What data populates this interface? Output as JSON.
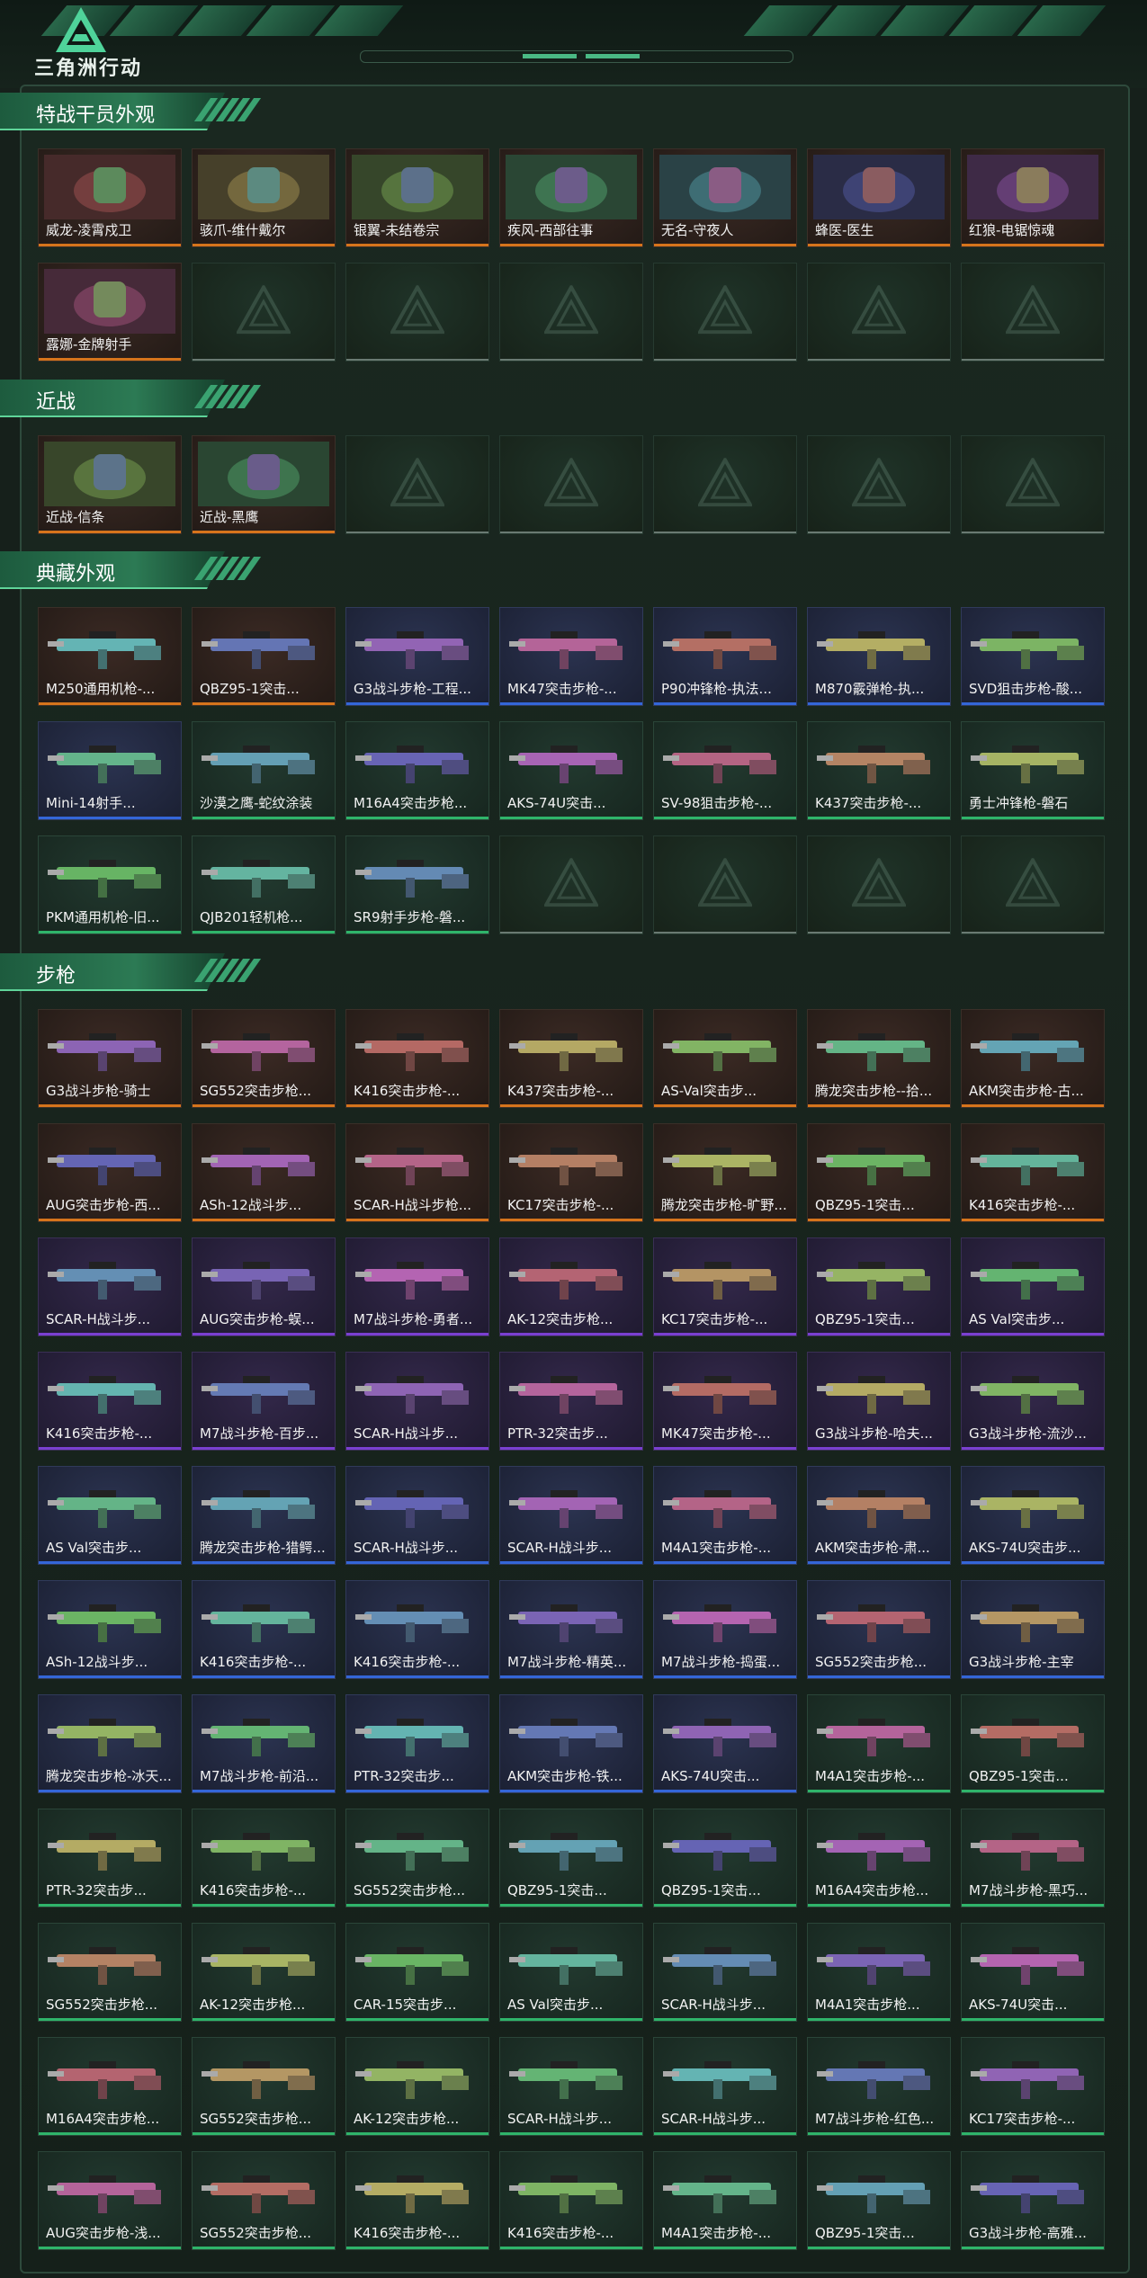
{
  "header": {
    "logo_text": "三角洲行动",
    "logo_icon": "delta-triangle-icon"
  },
  "sections": [
    {
      "title": "特战干员外观",
      "tier": "orange",
      "cols": 7,
      "slots": 14,
      "items": [
        "威龙-凌霄戍卫",
        "骇爪-维什戴尔",
        "银翼-未结卷宗",
        "疾风-西部往事",
        "无名-守夜人",
        "蜂医-医生",
        "红狼-电锯惊魂",
        "露娜-金牌射手"
      ]
    },
    {
      "title": "近战",
      "tier": "orange",
      "cols": 7,
      "slots": 7,
      "items": [
        "近战-信条",
        "近战-黑鹰"
      ]
    },
    {
      "title": "典藏外观",
      "tier": "mixed",
      "cols": 7,
      "slots": 21,
      "items": [
        "M250通用机枪-...",
        "QBZ95-1突击...",
        "G3战斗步枪-工程...",
        "MK47突击步枪-...",
        "P90冲锋枪-执法...",
        "M870霰弹枪-执...",
        "SVD狙击步枪-酸...",
        "Mini-14射手...",
        "沙漠之鹰-蛇纹涂装",
        "M16A4突击步枪...",
        "AKS-74U突击...",
        "SV-98狙击步枪-...",
        "K437突击步枪-...",
        "勇士冲锋枪-磐石",
        "PKM通用机枪-旧...",
        "QJB201轻机枪...",
        "SR9射手步枪-磐..."
      ],
      "tiers": [
        "orange",
        "orange",
        "blue",
        "blue",
        "blue",
        "blue",
        "blue",
        "blue",
        "green",
        "green",
        "green",
        "green",
        "green",
        "green",
        "green",
        "green",
        "green"
      ]
    },
    {
      "title": "步枪",
      "tier": "mixed",
      "cols": 7,
      "slots": 77,
      "items": [
        "G3战斗步枪-骑士",
        "SG552突击步枪...",
        "K416突击步枪-...",
        "K437突击步枪-...",
        "AS-Val突击步...",
        "腾龙突击步枪--拾...",
        "AKM突击步枪-古...",
        "AUG突击步枪-西...",
        "ASh-12战斗步...",
        "SCAR-H战斗步枪...",
        "KC17突击步枪-...",
        "腾龙突击步枪-旷野...",
        "QBZ95-1突击...",
        "K416突击步枪-...",
        "SCAR-H战斗步...",
        "AUG突击步枪-蜈...",
        "M7战斗步枪-勇者...",
        "AK-12突击步枪...",
        "KC17突击步枪-...",
        "QBZ95-1突击...",
        "AS Val突击步...",
        "K416突击步枪-...",
        "M7战斗步枪-百步...",
        "SCAR-H战斗步...",
        "PTR-32突击步...",
        "MK47突击步枪-...",
        "G3战斗步枪-哈夫...",
        "G3战斗步枪-流沙...",
        "AS Val突击步...",
        "腾龙突击步枪-猎鳄...",
        "SCAR-H战斗步...",
        "SCAR-H战斗步...",
        "M4A1突击步枪-...",
        "AKM突击步枪-肃...",
        "AKS-74U突击步...",
        "ASh-12战斗步...",
        "K416突击步枪-...",
        "K416突击步枪-...",
        "M7战斗步枪-精英...",
        "M7战斗步枪-捣蛋...",
        "SG552突击步枪...",
        "G3战斗步枪-主宰",
        "腾龙突击步枪-冰天...",
        "M7战斗步枪-前沿...",
        "PTR-32突击步...",
        "AKM突击步枪-铁...",
        "AKS-74U突击...",
        "M4A1突击步枪-...",
        "QBZ95-1突击...",
        "PTR-32突击步...",
        "K416突击步枪-...",
        "SG552突击步枪...",
        "QBZ95-1突击...",
        "QBZ95-1突击...",
        "M16A4突击步枪...",
        "M7战斗步枪-黑巧...",
        "SG552突击步枪...",
        "AK-12突击步枪...",
        "CAR-15突击步...",
        "AS Val突击步...",
        "SCAR-H战斗步...",
        "M4A1突击步枪...",
        "AKS-74U突击...",
        "M16A4突击步枪...",
        "SG552突击步枪...",
        "AK-12突击步枪...",
        "SCAR-H战斗步...",
        "SCAR-H战斗步...",
        "M7战斗步枪-红色...",
        "KC17突击步枪-...",
        "AUG突击步枪-浅...",
        "SG552突击步枪...",
        "K416突击步枪-...",
        "K416突击步枪-...",
        "M4A1突击步枪-...",
        "QBZ95-1突击...",
        "G3战斗步枪-高雅..."
      ],
      "tiers": [
        "orange",
        "orange",
        "orange",
        "orange",
        "orange",
        "orange",
        "orange",
        "orange",
        "orange",
        "orange",
        "orange",
        "orange",
        "orange",
        "orange",
        "purple",
        "purple",
        "purple",
        "purple",
        "purple",
        "purple",
        "purple",
        "purple",
        "purple",
        "purple",
        "purple",
        "purple",
        "purple",
        "purple",
        "blue",
        "blue",
        "blue",
        "blue",
        "blue",
        "blue",
        "blue",
        "blue",
        "blue",
        "blue",
        "blue",
        "blue",
        "blue",
        "blue",
        "blue",
        "blue",
        "blue",
        "blue",
        "blue",
        "green",
        "green",
        "green",
        "green",
        "green",
        "green",
        "green",
        "green",
        "green",
        "green",
        "green",
        "green",
        "green",
        "green",
        "green",
        "green",
        "green",
        "green",
        "green",
        "green",
        "green",
        "green",
        "green",
        "green",
        "green",
        "green",
        "green",
        "green",
        "green",
        "green"
      ]
    }
  ],
  "colors": {
    "orange": "#d6741c",
    "blue": "#3466d8",
    "purple": "#7a3fd1",
    "green": "#2fb46a",
    "accent": "#4ab984"
  }
}
